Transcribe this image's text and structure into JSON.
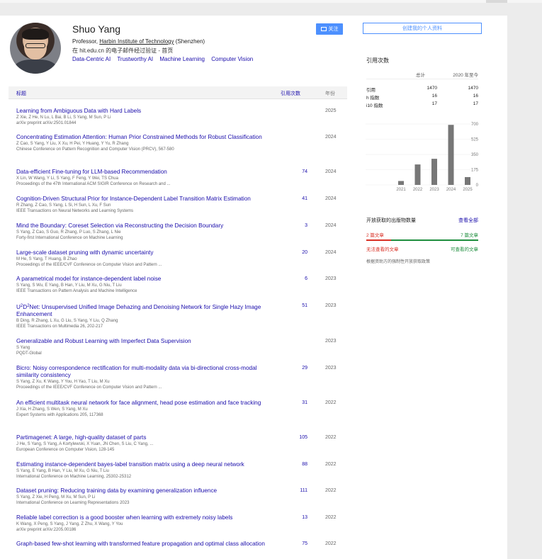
{
  "profile": {
    "name": "Shuo Yang",
    "affil_prefix": "Professor, ",
    "affil_link": "Harbin Institute of Technology",
    "affil_suffix": " (Shenzhen)",
    "verified": "在 hit.edu.cn 的电子邮件经过验证 - 首页",
    "interests": [
      "Data-Centric AI",
      "Trustworthy AI",
      "Machine Learning",
      "Computer Vision"
    ],
    "follow_label": "关注",
    "create_label": "创建我的个人资料"
  },
  "table": {
    "col_title": "标题",
    "col_cited": "引用次数",
    "col_year": "年份"
  },
  "papers": [
    {
      "title": "Learning from Ambiguous Data with Hard Labels",
      "authors": "Z Xie, Z He, N Lu, L Bai, B Li, S Yang, M Sun, P Li",
      "venue": "arXiv preprint arXiv:2501.01844",
      "cites": "",
      "year": "2025"
    },
    {
      "title": "Concentrating Estimation Attention: Human Prior Constrained Methods for Robust Classification",
      "authors": "Z Cao, S Yang, Y Liu, X Xu, H Pei, Y Huang, Y Yu, R Zhang",
      "venue": "Chinese Conference on Pattern Recognition and Computer Vision (PRCV), 567-580",
      "cites": "",
      "year": "2024"
    },
    {
      "title": "Data-efficient Fine-tuning for LLM-based Recommendation",
      "authors": "X Lin, W Wang, Y Li, S Yang, F Feng, Y Wei, TS Chua",
      "venue": "Proceedings of the 47th International ACM SIGIR Conference on Research and ...",
      "cites": "74",
      "year": "2024"
    },
    {
      "title": "Cognition-Driven Structural Prior for Instance-Dependent Label Transition Matrix Estimation",
      "authors": "R Zhang, Z Cao, S Yang, L Si, H Sun, L Xu, F Sun",
      "venue": "IEEE Transactions on Neural Networks and Learning Systems",
      "cites": "41",
      "year": "2024"
    },
    {
      "title": "Mind the Boundary: Coreset Selection via Reconstructing the Decision Boundary",
      "authors": "S Yang, Z Cao, S Guo, R Zhang, P Luo, S Zhang, L Nie",
      "venue": "Forty-first International Conference on Machine Learning",
      "cites": "3",
      "year": "2024"
    },
    {
      "title": "Large-scale dataset pruning with dynamic uncertainty",
      "authors": "M He, S Yang, T Huang, B Zhao",
      "venue": "Proceedings of the IEEE/CVF Conference on Computer Vision and Pattern ...",
      "cites": "20",
      "year": "2024"
    },
    {
      "title": "A parametrical model for instance-dependent label noise",
      "authors": "S Yang, S Wu, E Yang, B Han, Y Liu, M Xu, G Niu, T Liu",
      "venue": "IEEE Transactions on Pattern Analysis and Machine Intelligence",
      "cites": "6",
      "year": "2023"
    },
    {
      "title_rich": true,
      "title": "Net: Unsupervised Unified Image Dehazing and Denoising Network for Single Hazy Image Enhancement",
      "authors": "B Ding, R Zhang, L Xu, G Liu, S Yang, Y Liu, Q Zhang",
      "venue": "IEEE Transactions on Multimedia 26, 202-217",
      "cites": "51",
      "year": "2023"
    },
    {
      "title": "Generalizable and Robust Learning with Imperfect Data Supervision",
      "authors": "S Yang",
      "venue": "PQDT-Global",
      "cites": "",
      "year": "2023"
    },
    {
      "title": "Bicro: Noisy correspondence rectification for multi-modality data via bi-directional cross-modal similarity consistency",
      "authors": "S Yang, Z Xu, K Wang, Y You, H Yao, T Liu, M Xu",
      "venue": "Proceedings of the IEEE/CVF Conference on Computer Vision and Pattern ...",
      "cites": "29",
      "year": "2023"
    },
    {
      "title": "An efficient multitask neural network for face alignment, head pose estimation and face tracking",
      "authors": "J Xia, H Zhang, S Wen, S Yang, M Xu",
      "venue": "Expert Systems with Applications 205, 117368",
      "cites": "31",
      "year": "2022"
    },
    {
      "title": "Partimagenet: A large, high-quality dataset of parts",
      "authors": "J He, S Yang, S Yang, A Kortylewski, X Yuan, JN Chen, S Liu, C Yang, ...",
      "venue": "European Conference on Computer Vision, 128-145",
      "cites": "105",
      "year": "2022"
    },
    {
      "title": "Estimating instance-dependent bayes-label transition matrix using a deep neural network",
      "authors": "S Yang, E Yang, B Han, Y Liu, M Xu, G Niu, T Liu",
      "venue": "International Conference on Machine Learning, 25302-25312",
      "cites": "88",
      "year": "2022"
    },
    {
      "title": "Dataset pruning: Reducing training data by examining generalization influence",
      "authors": "S Yang, Z Xie, H Peng, M Xu, M Sun, P Li",
      "venue": "International Conference on Learning Representations 2023",
      "cites": "111",
      "year": "2022"
    },
    {
      "title": "Reliable label correction is a good booster when learning with extremely noisy labels",
      "authors": "K Wang, X Peng, S Yang, J Yang, Z Zhu, X Wang, Y You",
      "venue": "arXiv preprint arXiv:2205.00186",
      "cites": "13",
      "year": "2022"
    },
    {
      "title": "Graph-based few-shot learning with transformed feature propagation and optimal class allocation",
      "authors": "",
      "venue": "",
      "cites": "75",
      "year": "2022"
    }
  ],
  "udn": {
    "u": "U",
    "sup1": "2",
    "d": "D",
    "sup2": "2"
  },
  "citations": {
    "heading": "引用次数",
    "col_all": "总计",
    "col_since": "2020 年至今",
    "rows": [
      {
        "label": "引用",
        "all": "1470",
        "since": "1470"
      },
      {
        "label": "h 指数",
        "all": "16",
        "since": "16"
      },
      {
        "label": "i10 指数",
        "all": "17",
        "since": "17"
      }
    ]
  },
  "chart_data": {
    "type": "bar",
    "categories": [
      "2021",
      "2022",
      "2023",
      "2024",
      "2025"
    ],
    "values": [
      45,
      235,
      300,
      690,
      90
    ],
    "ylim": [
      0,
      700
    ],
    "yticks": [
      "700",
      "525",
      "350",
      "175",
      "0"
    ],
    "bar_color": "#777777"
  },
  "open_access": {
    "heading": "开放获取的出版物数量",
    "view_all": "查看全部",
    "left_count": "2 篇文章",
    "right_count": "7 篇文章",
    "left_label": "无法查看的文章",
    "right_label": "可查看的文章",
    "note": "根据资助方的强制性开放获取政策",
    "colors": {
      "unavailable": "#d93025",
      "available": "#1e8e3e"
    }
  }
}
